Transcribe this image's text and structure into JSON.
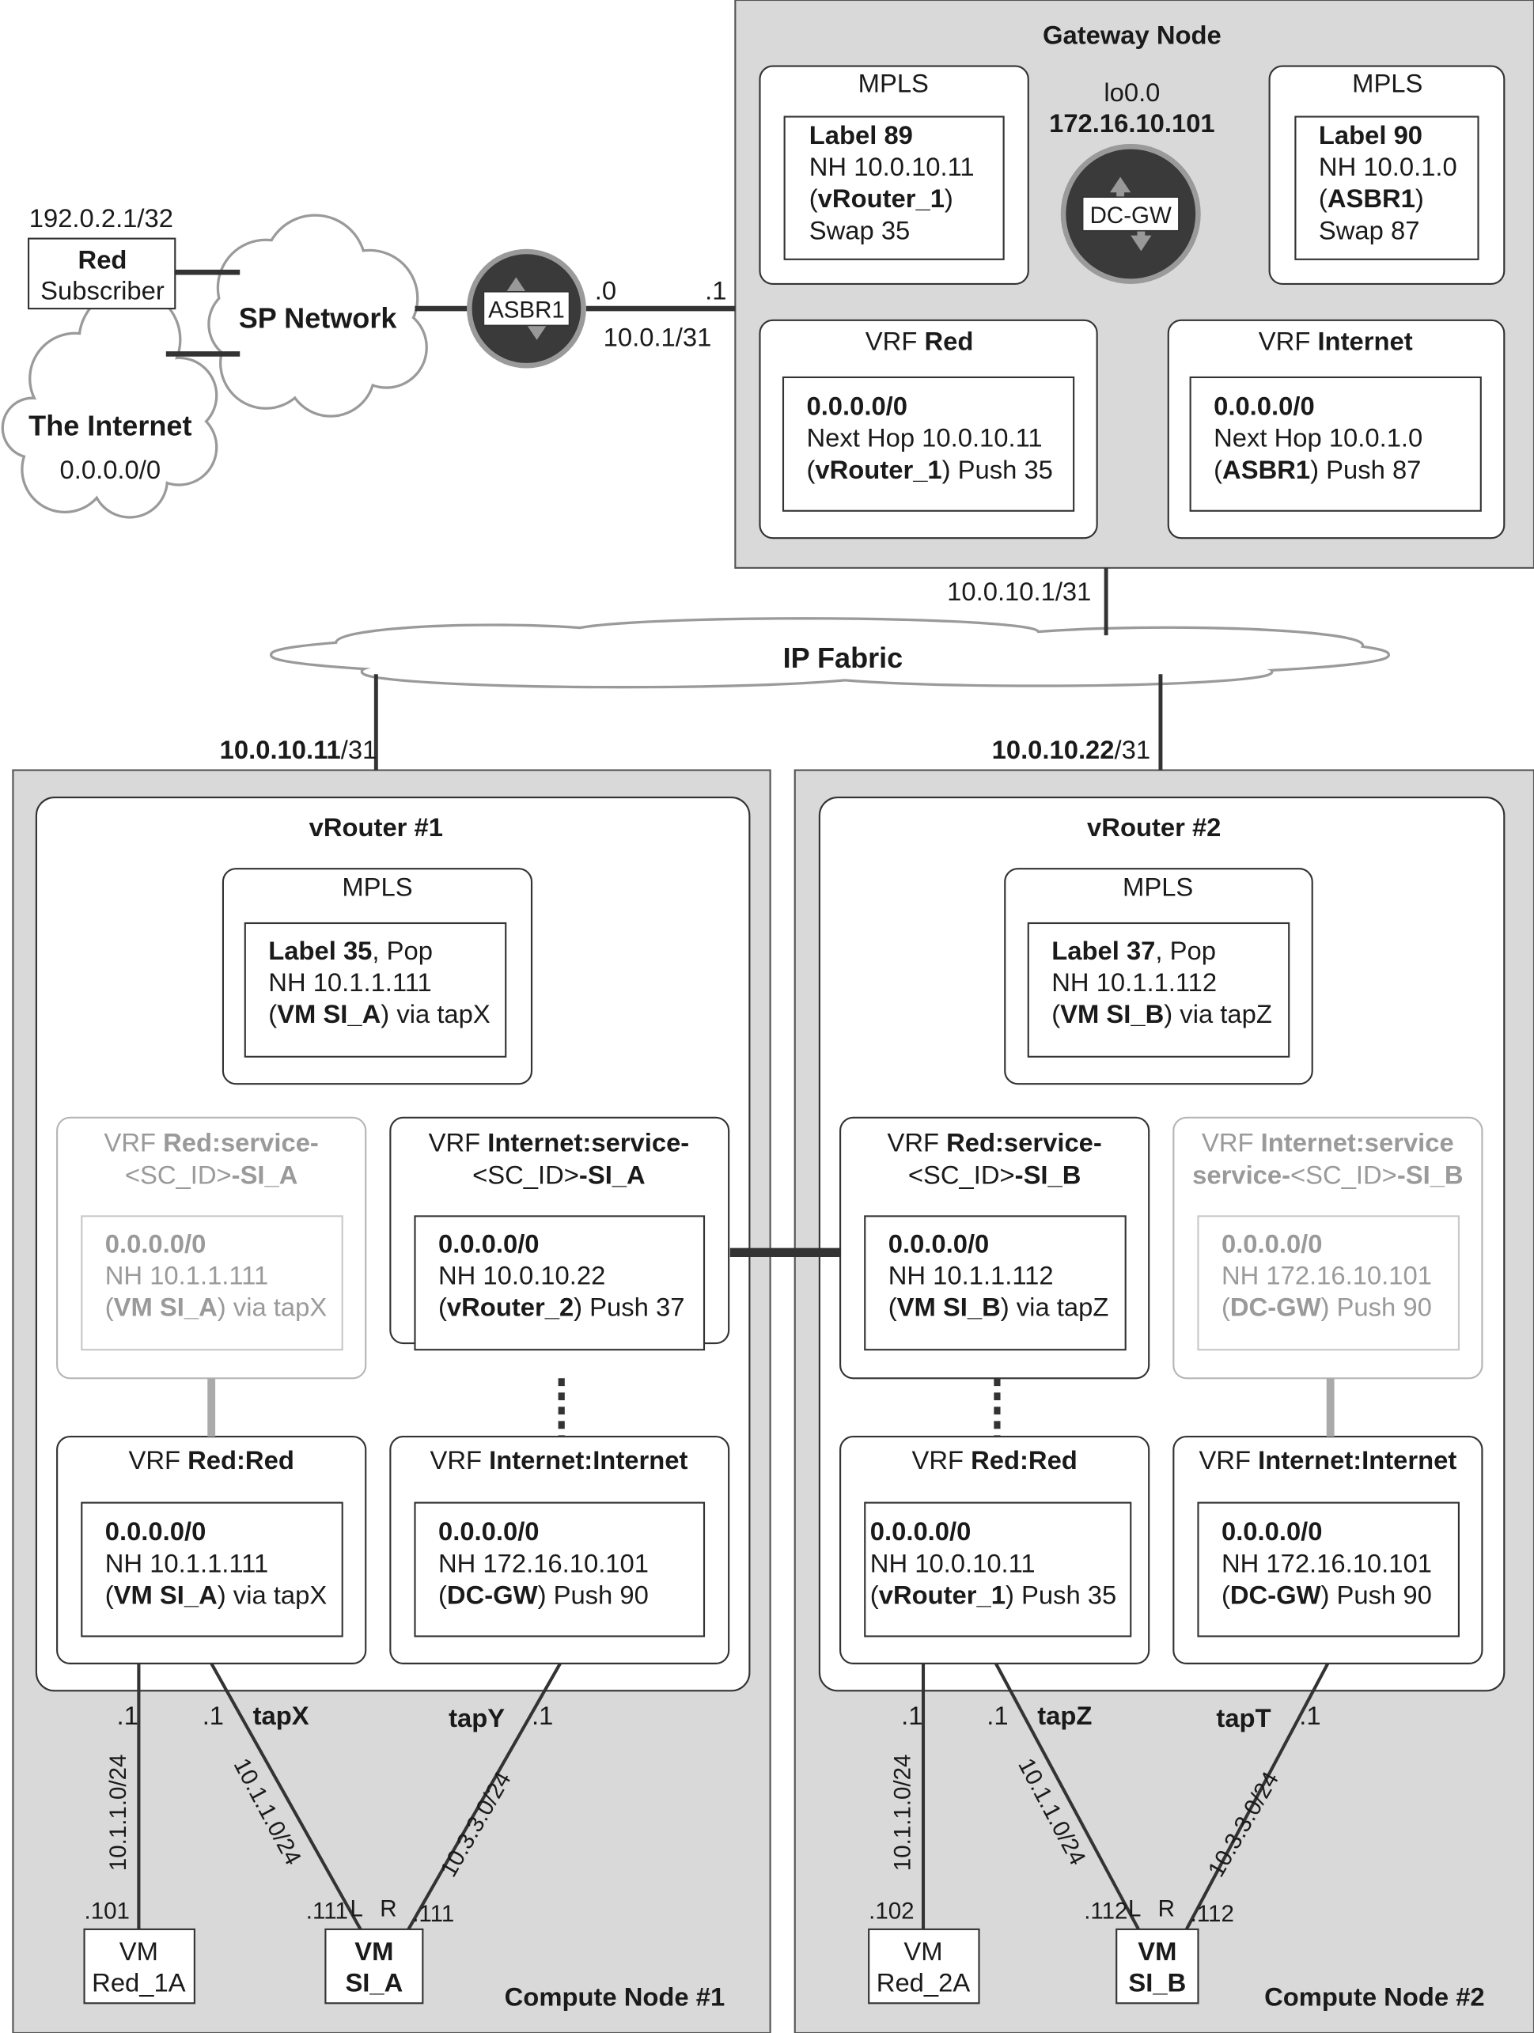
{
  "colors": {
    "node_fill": "#d9d9d9",
    "node_border": "#555555",
    "router_fill": "#3a3a3a",
    "cloud_stroke": "#9a9a9a",
    "inactive_text": "#9a9a9a"
  },
  "icons": {
    "router": "router-arrows-icon",
    "cloud": "cloud-icon"
  },
  "red_subscriber": {
    "prefix": "192.0.2.1/32",
    "line1": "Red",
    "line2": "Subscriber"
  },
  "sp_network": {
    "label": "SP Network"
  },
  "internet": {
    "label": "The Internet",
    "prefix": "0.0.0.0/0"
  },
  "asbr1": {
    "label": "ASBR1",
    "left_addr": ".0",
    "right_addr": ".1",
    "subnet": "10.0.1/31"
  },
  "gateway_node": {
    "title": "Gateway Node",
    "loopback": "lo0.0",
    "loopback_ip": "172.16.10.101",
    "router_label": "DC-GW",
    "uplink": "10.0.10.1/31",
    "mpls_left": {
      "title": [
        [
          {
            "t": "MPLS"
          }
        ]
      ],
      "lines": [
        [
          {
            "t": "Label 89",
            "b": true
          }
        ],
        [
          {
            "t": "NH 10.0.10.11"
          }
        ],
        [
          {
            "t": "("
          },
          {
            "t": "vRouter_1",
            "b": true
          },
          {
            "t": ")"
          }
        ],
        [
          {
            "t": "Swap 35"
          }
        ]
      ]
    },
    "mpls_right": {
      "title": [
        [
          {
            "t": "MPLS"
          }
        ]
      ],
      "lines": [
        [
          {
            "t": "Label 90",
            "b": true
          }
        ],
        [
          {
            "t": "NH 10.0.1.0"
          }
        ],
        [
          {
            "t": "("
          },
          {
            "t": "ASBR1",
            "b": true
          },
          {
            "t": ")"
          }
        ],
        [
          {
            "t": "Swap 87"
          }
        ]
      ]
    },
    "vrf_red": {
      "title": [
        [
          {
            "t": "VRF "
          },
          {
            "t": "Red",
            "b": true
          }
        ]
      ],
      "lines": [
        [
          {
            "t": "0.0.0.0/0",
            "b": true
          }
        ],
        [
          {
            "t": "Next Hop 10.0.10.11"
          }
        ],
        [
          {
            "t": "("
          },
          {
            "t": "vRouter_1",
            "b": true
          },
          {
            "t": ") Push 35"
          }
        ]
      ]
    },
    "vrf_internet": {
      "title": [
        [
          {
            "t": "VRF "
          },
          {
            "t": "Internet",
            "b": true
          }
        ]
      ],
      "lines": [
        [
          {
            "t": "0.0.0.0/0",
            "b": true
          }
        ],
        [
          {
            "t": "Next Hop 10.0.1.0"
          }
        ],
        [
          {
            "t": "("
          },
          {
            "t": "ASBR1",
            "b": true
          },
          {
            "t": ") Push 87"
          }
        ]
      ]
    }
  },
  "ip_fabric": {
    "label": "IP Fabric"
  },
  "compute_node_1": {
    "title": "Compute Node #1",
    "uplink_bold": "10.0.10.11",
    "uplink_suffix": "/31",
    "vrouter": {
      "title": "vRouter #1",
      "mpls": {
        "title": [
          [
            {
              "t": "MPLS"
            }
          ]
        ],
        "lines": [
          [
            {
              "t": "Label 35",
              "b": true
            },
            {
              "t": ", Pop"
            }
          ],
          [
            {
              "t": "NH 10.1.1.111"
            }
          ],
          [
            {
              "t": "("
            },
            {
              "t": "VM SI_A",
              "b": true
            },
            {
              "t": ") via tapX"
            }
          ]
        ]
      },
      "vrf_red_service": {
        "title": [
          [
            {
              "t": "VRF "
            },
            {
              "t": "Red:service-",
              "b": true
            }
          ],
          [
            {
              "t": "<SC_ID>"
            },
            {
              "t": "-SI_A",
              "b": true
            }
          ]
        ],
        "lines": [
          [
            {
              "t": "0.0.0.0/0",
              "b": true
            }
          ],
          [
            {
              "t": "NH 10.1.1.111"
            }
          ],
          [
            {
              "t": "("
            },
            {
              "t": "VM SI_A",
              "b": true
            },
            {
              "t": ") via tapX"
            }
          ]
        ]
      },
      "vrf_internet_service": {
        "title": [
          [
            {
              "t": "VRF "
            },
            {
              "t": "Internet:service-",
              "b": true
            }
          ],
          [
            {
              "t": "<SC_ID>"
            },
            {
              "t": "-SI_A",
              "b": true
            }
          ]
        ],
        "lines": [
          [
            {
              "t": "0.0.0.0/0",
              "b": true
            }
          ],
          [
            {
              "t": "NH 10.0.10.22"
            }
          ],
          [
            {
              "t": "("
            },
            {
              "t": "vRouter_2",
              "b": true
            },
            {
              "t": ") Push 37"
            }
          ]
        ]
      },
      "vrf_red_red": {
        "title": [
          [
            {
              "t": "VRF "
            },
            {
              "t": "Red:Red",
              "b": true
            }
          ]
        ],
        "lines": [
          [
            {
              "t": "0.0.0.0/0",
              "b": true
            }
          ],
          [
            {
              "t": "NH 10.1.1.111"
            }
          ],
          [
            {
              "t": "("
            },
            {
              "t": "VM SI_A",
              "b": true
            },
            {
              "t": ") via tapX"
            }
          ]
        ]
      },
      "vrf_internet_internet": {
        "title": [
          [
            {
              "t": "VRF "
            },
            {
              "t": "Internet:Internet",
              "b": true
            }
          ]
        ],
        "lines": [
          [
            {
              "t": "0.0.0.0/0",
              "b": true
            }
          ],
          [
            {
              "t": "NH 172.16.10.101"
            }
          ],
          [
            {
              "t": "("
            },
            {
              "t": "DC-GW",
              "b": true
            },
            {
              "t": ") Push 90"
            }
          ]
        ]
      }
    },
    "links": {
      "red_gw": ".1",
      "red_subnet": "10.1.1.0/24",
      "red_vm_addr": ".101",
      "tap_left_gw": ".1",
      "tap_left_name": "tapX",
      "tap_left_subnet": "10.1.1.0/24",
      "tap_left_vm_addr": ".111",
      "tap_right_gw": ".1",
      "tap_right_name": "tapY",
      "tap_right_subnet": "10.3.3.0/24",
      "tap_right_vm_addr": ".111",
      "left_if": "L",
      "right_if": "R"
    },
    "vm_red": {
      "line1": "VM",
      "line2": "Red_1A"
    },
    "vm_si": {
      "line1": "VM",
      "line2": "SI_A"
    }
  },
  "compute_node_2": {
    "title": "Compute Node #2",
    "uplink_bold": "10.0.10.22",
    "uplink_suffix": "/31",
    "vrouter": {
      "title": "vRouter #2",
      "mpls": {
        "title": [
          [
            {
              "t": "MPLS"
            }
          ]
        ],
        "lines": [
          [
            {
              "t": "Label 37",
              "b": true
            },
            {
              "t": ", Pop"
            }
          ],
          [
            {
              "t": "NH 10.1.1.112"
            }
          ],
          [
            {
              "t": "("
            },
            {
              "t": "VM SI_B",
              "b": true
            },
            {
              "t": ") via tapZ"
            }
          ]
        ]
      },
      "vrf_red_service": {
        "title": [
          [
            {
              "t": "VRF "
            },
            {
              "t": "Red:service-",
              "b": true
            }
          ],
          [
            {
              "t": "<SC_ID>"
            },
            {
              "t": "-SI_B",
              "b": true
            }
          ]
        ],
        "lines": [
          [
            {
              "t": "0.0.0.0/0",
              "b": true
            }
          ],
          [
            {
              "t": "NH 10.1.1.112"
            }
          ],
          [
            {
              "t": "("
            },
            {
              "t": "VM SI_B",
              "b": true
            },
            {
              "t": ") via tapZ"
            }
          ]
        ]
      },
      "vrf_internet_service": {
        "title": [
          [
            {
              "t": "VRF "
            },
            {
              "t": "Internet:service",
              "b": true
            }
          ],
          [
            {
              "t": "service-",
              "b": true
            },
            {
              "t": "<SC_ID>"
            },
            {
              "t": "-SI_B",
              "b": true
            }
          ]
        ],
        "lines": [
          [
            {
              "t": "0.0.0.0/0",
              "b": true
            }
          ],
          [
            {
              "t": "NH 172.16.10.101"
            }
          ],
          [
            {
              "t": "("
            },
            {
              "t": "DC-GW",
              "b": true
            },
            {
              "t": ") Push 90"
            }
          ]
        ]
      },
      "vrf_red_red": {
        "title": [
          [
            {
              "t": "VRF "
            },
            {
              "t": "Red:Red",
              "b": true
            }
          ]
        ],
        "lines": [
          [
            {
              "t": "0.0.0.0/0",
              "b": true
            }
          ],
          [
            {
              "t": "NH 10.0.10.11"
            }
          ],
          [
            {
              "t": "("
            },
            {
              "t": "vRouter_1",
              "b": true
            },
            {
              "t": ") Push 35"
            }
          ]
        ]
      },
      "vrf_internet_internet": {
        "title": [
          [
            {
              "t": "VRF "
            },
            {
              "t": "Internet:Internet",
              "b": true
            }
          ]
        ],
        "lines": [
          [
            {
              "t": "0.0.0.0/0",
              "b": true
            }
          ],
          [
            {
              "t": "NH 172.16.10.101"
            }
          ],
          [
            {
              "t": "("
            },
            {
              "t": "DC-GW",
              "b": true
            },
            {
              "t": ") Push 90"
            }
          ]
        ]
      }
    },
    "links": {
      "red_gw": ".1",
      "red_subnet": "10.1.1.0/24",
      "red_vm_addr": ".102",
      "tap_left_gw": ".1",
      "tap_left_name": "tapZ",
      "tap_left_subnet": "10.1.1.0/24",
      "tap_left_vm_addr": ".112",
      "tap_right_gw": ".1",
      "tap_right_name": "tapT",
      "tap_right_subnet": "10.3.3.0/24",
      "tap_right_vm_addr": ".112",
      "left_if": "L",
      "right_if": "R"
    },
    "vm_red": {
      "line1": "VM",
      "line2": "Red_2A"
    },
    "vm_si": {
      "line1": "VM",
      "line2": "SI_B"
    }
  }
}
